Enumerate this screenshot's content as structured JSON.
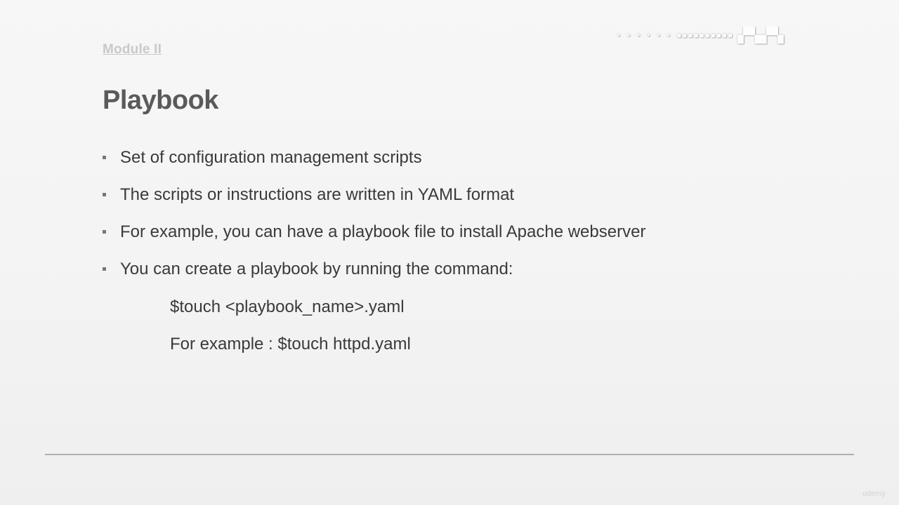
{
  "slide": {
    "module_label": "Module II",
    "title": "Playbook",
    "bullets": [
      "Set of configuration management scripts",
      "The scripts or instructions are written in YAML format",
      "For example, you can have a playbook file to install Apache webserver",
      "You can create a playbook by running the command:"
    ],
    "command_lines": [
      "$touch <playbook_name>.yaml",
      "For example : $touch httpd.yaml"
    ]
  },
  "watermarks": {
    "udemy": "udemy"
  },
  "colors": {
    "background": "#f4f4f4",
    "title": "#5a5a5a",
    "body_text": "#3a3a3a",
    "module_label": "#c9c9c9",
    "divider": "#b0b0b0"
  }
}
